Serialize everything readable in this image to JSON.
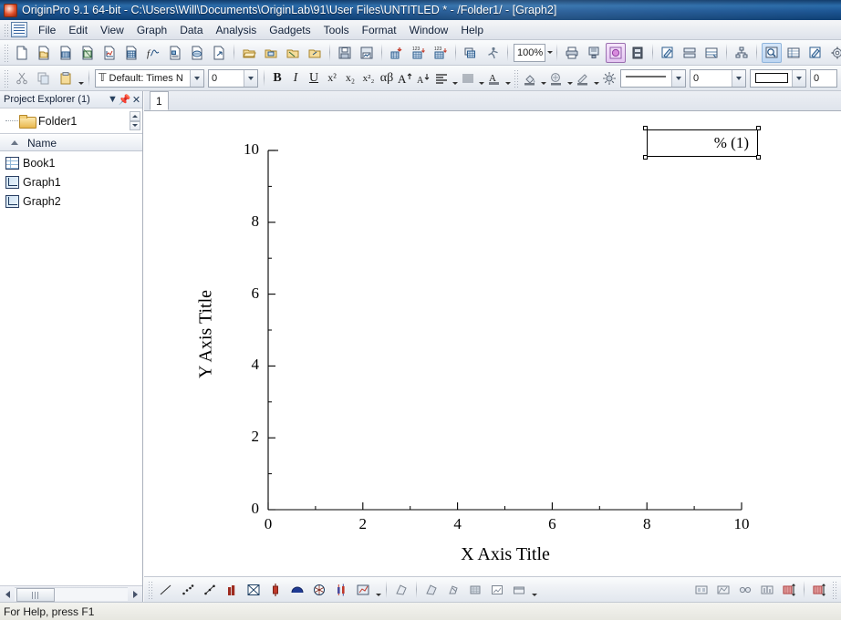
{
  "window": {
    "title": "OriginPro 9.1 64-bit - C:\\Users\\Will\\Documents\\OriginLab\\91\\User Files\\UNTITLED * - /Folder1/ - [Graph2]",
    "app_icon": "origin-app-icon"
  },
  "menubar": {
    "items": [
      {
        "label": "File"
      },
      {
        "label": "Edit"
      },
      {
        "label": "View"
      },
      {
        "label": "Graph"
      },
      {
        "label": "Data"
      },
      {
        "label": "Analysis"
      },
      {
        "label": "Gadgets"
      },
      {
        "label": "Tools"
      },
      {
        "label": "Format"
      },
      {
        "label": "Window"
      },
      {
        "label": "Help"
      }
    ]
  },
  "standard_toolbar": {
    "zoom": {
      "value": "100%"
    },
    "buttons": [
      {
        "name": "new-project-button",
        "icon": "new-project-icon"
      },
      {
        "name": "new-folder-button",
        "icon": "new-folder-icon"
      },
      {
        "name": "new-workbook-button",
        "icon": "new-workbook-icon"
      },
      {
        "name": "new-excel-button",
        "icon": "new-excel-icon"
      },
      {
        "name": "new-graph-button",
        "icon": "new-graph-icon"
      },
      {
        "name": "new-matrix-button",
        "icon": "new-matrix-icon"
      },
      {
        "name": "new-function-plot-button",
        "icon": "new-function-plot-icon"
      },
      {
        "name": "new-layout-button",
        "icon": "new-layout-icon"
      },
      {
        "name": "new-notes-button",
        "icon": "new-notes-icon"
      },
      {
        "name": "new-project-from-template-button",
        "icon": "new-template-icon"
      },
      {
        "name": "open-project-button",
        "icon": "open-folder-icon"
      },
      {
        "name": "open-template-button",
        "icon": "open-template-icon"
      },
      {
        "name": "open-excel-button",
        "icon": "open-excel-icon"
      },
      {
        "name": "append-project-button",
        "icon": "append-project-icon"
      },
      {
        "name": "save-project-button",
        "icon": "save-disk-icon"
      },
      {
        "name": "save-template-button",
        "icon": "save-template-icon"
      },
      {
        "name": "import-wizard-button",
        "icon": "import-wizard-icon"
      },
      {
        "name": "import-single-ascii-button",
        "icon": "import-ascii-icon"
      },
      {
        "name": "import-multiple-ascii-button",
        "icon": "import-multi-ascii-icon"
      },
      {
        "name": "duplicate-button",
        "icon": "duplicate-icon"
      },
      {
        "name": "run-script-button",
        "icon": "running-man-icon"
      },
      {
        "name": "print-button",
        "icon": "printer-icon"
      },
      {
        "name": "print-preview-button",
        "icon": "print-preview-icon"
      },
      {
        "name": "copy-page-button",
        "icon": "copy-page-icon"
      },
      {
        "name": "send-graph-button",
        "icon": "film-strip-icon"
      },
      {
        "name": "new-layer-button",
        "icon": "pencil-page-icon"
      },
      {
        "name": "extract-layers-button",
        "icon": "extract-layers-icon"
      },
      {
        "name": "merge-graphs-button",
        "icon": "merge-graphs-icon"
      },
      {
        "name": "layer-management-button",
        "icon": "hierarchy-icon"
      },
      {
        "name": "zoom-panel-button",
        "icon": "magnifier-page-icon"
      },
      {
        "name": "results-log-button",
        "icon": "results-log-icon"
      },
      {
        "name": "script-window-button",
        "icon": "script-window-icon"
      },
      {
        "name": "code-builder-button",
        "icon": "code-builder-icon"
      },
      {
        "name": "add-new-columns-button",
        "icon": "add-column-icon"
      },
      {
        "name": "statistics-on-columns-button",
        "icon": "sigma-icon"
      }
    ]
  },
  "format_toolbar": {
    "font": {
      "value": "Default: Times N",
      "icon": "font-icon"
    },
    "font_size": {
      "value": "0"
    },
    "line_width": {
      "value": "0"
    },
    "pattern_value": {
      "value": "0"
    },
    "buttons": [
      {
        "name": "cut-button",
        "icon": "scissors-icon"
      },
      {
        "name": "copy-button",
        "icon": "copy-icon"
      },
      {
        "name": "paste-button",
        "icon": "paste-icon"
      },
      {
        "name": "bold-button",
        "label": "B"
      },
      {
        "name": "italic-button",
        "label": "I"
      },
      {
        "name": "underline-button",
        "label": "U"
      },
      {
        "name": "superscript-button",
        "label": "x²"
      },
      {
        "name": "subscript-button",
        "label": "x₂"
      },
      {
        "name": "superscript-subscript-button",
        "label": "x²₂"
      },
      {
        "name": "greek-button",
        "label": "αβ"
      },
      {
        "name": "increase-font-button",
        "icon": "increase-font-icon"
      },
      {
        "name": "decrease-font-button",
        "icon": "decrease-font-icon"
      },
      {
        "name": "text-align-button",
        "icon": "align-icon"
      },
      {
        "name": "line-spacing-button",
        "icon": "line-spacing-icon"
      },
      {
        "name": "font-color-button",
        "icon": "font-color-icon"
      },
      {
        "name": "fill-color-button",
        "icon": "fill-color-icon"
      },
      {
        "name": "pattern-button",
        "icon": "pattern-icon"
      },
      {
        "name": "line-color-button",
        "icon": "line-color-icon"
      },
      {
        "name": "rescale-button",
        "icon": "sun-rescale-icon"
      }
    ]
  },
  "project_explorer": {
    "title": "Project Explorer (1)",
    "menu_icon": "chevron-down-icon",
    "pin_icon": "pin-icon",
    "close_icon": "close-icon",
    "folder": {
      "label": "Folder1",
      "icon": "folder-icon"
    },
    "column_header": {
      "label": "Name",
      "sort_icon": "sort-ascending-icon"
    },
    "items": [
      {
        "label": "Book1",
        "icon": "workbook-icon"
      },
      {
        "label": "Graph1",
        "icon": "graph-icon"
      },
      {
        "label": "Graph2",
        "icon": "graph-icon"
      }
    ]
  },
  "graph_window": {
    "tabs": [
      {
        "label": "1"
      }
    ],
    "legend": {
      "text": "% (1)"
    }
  },
  "chart_data": {
    "type": "scatter",
    "title": "",
    "xlabel": "X Axis Title",
    "ylabel": "Y Axis Title",
    "xlim": [
      0,
      10
    ],
    "ylim": [
      0,
      10
    ],
    "xticks": [
      "0",
      "2",
      "4",
      "6",
      "8",
      "10"
    ],
    "yticks": [
      "0",
      "2",
      "4",
      "6",
      "8",
      "10"
    ],
    "xtick_values": [
      0,
      2,
      4,
      6,
      8,
      10
    ],
    "ytick_values": [
      0,
      2,
      4,
      6,
      8,
      10
    ],
    "minor_ticks": true,
    "grid": false,
    "legend_position": "top-right",
    "series": [
      {
        "name": "% (1)",
        "x": [],
        "y": []
      }
    ],
    "axis_color": "#000000",
    "background": "#ffffff"
  },
  "bottom_toolbar": {
    "buttons": [
      {
        "name": "line-plot-button",
        "icon": "line-plot-icon"
      },
      {
        "name": "scatter-plot-button",
        "icon": "scatter-plot-icon"
      },
      {
        "name": "line-symbol-plot-button",
        "icon": "line-symbol-icon"
      },
      {
        "name": "column-plot-button",
        "icon": "column-plot-icon"
      },
      {
        "name": "area-plot-button",
        "icon": "area-plot-icon"
      },
      {
        "name": "floating-column-button",
        "icon": "floating-column-icon"
      },
      {
        "name": "polar-plot-button",
        "icon": "polar-plot-icon"
      },
      {
        "name": "ternary-plot-button",
        "icon": "ternary-plot-icon"
      },
      {
        "name": "box-chart-button",
        "icon": "box-chart-icon"
      },
      {
        "name": "3d-scatter-button",
        "icon": "3d-scatter-icon"
      },
      {
        "name": "3d-surface-button",
        "icon": "3d-surface-icon"
      },
      {
        "name": "3d-bar-button",
        "icon": "3d-bar-icon"
      },
      {
        "name": "contour-button",
        "icon": "contour-icon"
      },
      {
        "name": "image-plot-button",
        "icon": "image-plot-icon"
      },
      {
        "name": "matrix-image-button",
        "icon": "matrix-image-icon"
      },
      {
        "name": "mask-points-button",
        "icon": "mask-points-icon"
      },
      {
        "name": "mask-range-button",
        "icon": "mask-range-icon"
      },
      {
        "name": "swap-mask-button",
        "icon": "swap-mask-icon"
      },
      {
        "name": "hide-unhide-button",
        "icon": "hide-unhide-icon"
      },
      {
        "name": "mask-data-button",
        "icon": "mask-data-icon"
      },
      {
        "name": "unmask-button",
        "icon": "unmask-icon"
      }
    ]
  },
  "statusbar": {
    "message": "For Help, press F1"
  }
}
